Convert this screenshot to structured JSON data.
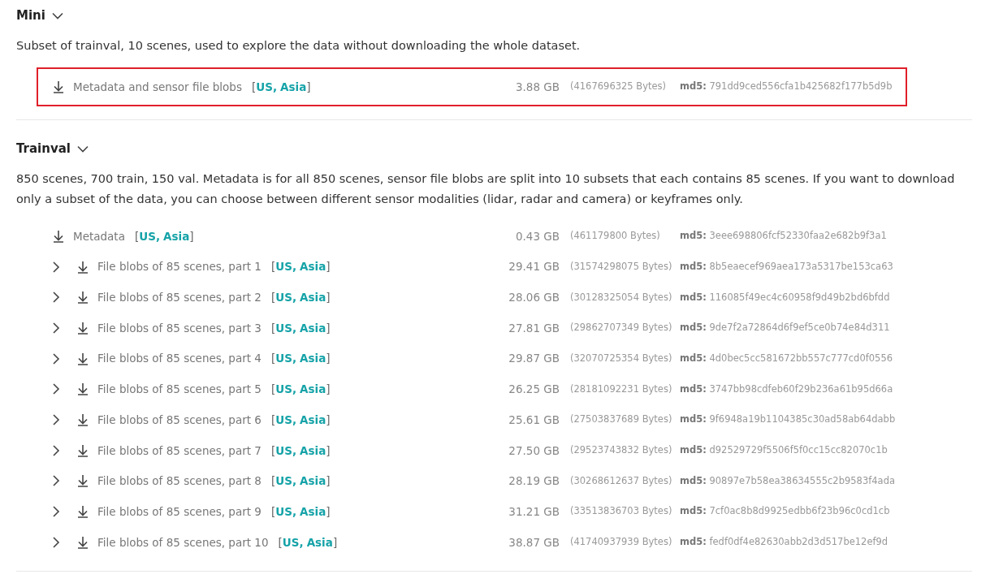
{
  "sections": [
    {
      "title": "Mini",
      "expanded": true,
      "description": "Subset of trainval, 10 scenes, used to explore the data without downloading the whole dataset.",
      "files": [
        {
          "name": "Metadata and sensor file blobs",
          "expandable": false,
          "highlighted": true,
          "regions": [
            {
              "kind": "punct",
              "text": "["
            },
            {
              "kind": "link",
              "text": "US"
            },
            {
              "kind": "punct",
              "text": ","
            },
            {
              "kind": "link",
              "text": "Asia"
            },
            {
              "kind": "punct",
              "text": "]"
            }
          ],
          "size": "3.88 GB",
          "bytes": "(4167696325 Bytes)",
          "md5_label": "md5:",
          "md5": "791dd9ced556cfa1b425682f177b5d9b"
        }
      ]
    },
    {
      "title": "Trainval",
      "expanded": true,
      "description": "850 scenes, 700 train, 150 val. Metadata is for all 850 scenes, sensor file blobs are split into 10 subsets that each contains 85 scenes. If you want to download only a subset of the data, you can choose between different sensor modalities (lidar, radar and camera) or keyframes only.",
      "files": [
        {
          "name": "Metadata",
          "expandable": false,
          "highlighted": false,
          "regions": [
            {
              "kind": "punct",
              "text": "["
            },
            {
              "kind": "link",
              "text": "US"
            },
            {
              "kind": "punct",
              "text": ","
            },
            {
              "kind": "link",
              "text": "Asia"
            },
            {
              "kind": "punct",
              "text": "]"
            }
          ],
          "size": "0.43 GB",
          "bytes": "(461179800 Bytes)",
          "md5_label": "md5:",
          "md5": "3eee698806fcf52330faa2e682b9f3a1"
        },
        {
          "name": "File blobs of 85 scenes, part 1",
          "expandable": true,
          "highlighted": false,
          "regions": [
            {
              "kind": "punct",
              "text": "["
            },
            {
              "kind": "link",
              "text": "US"
            },
            {
              "kind": "punct",
              "text": ","
            },
            {
              "kind": "link",
              "text": "Asia"
            },
            {
              "kind": "punct",
              "text": "]"
            }
          ],
          "size": "29.41 GB",
          "bytes": "(31574298075 Bytes)",
          "md5_label": "md5:",
          "md5": "8b5eaecef969aea173a5317be153ca63"
        },
        {
          "name": "File blobs of 85 scenes, part 2",
          "expandable": true,
          "highlighted": false,
          "regions": [
            {
              "kind": "punct",
              "text": "["
            },
            {
              "kind": "link",
              "text": "US"
            },
            {
              "kind": "punct",
              "text": ","
            },
            {
              "kind": "link",
              "text": "Asia"
            },
            {
              "kind": "punct",
              "text": "]"
            }
          ],
          "size": "28.06 GB",
          "bytes": "(30128325054 Bytes)",
          "md5_label": "md5:",
          "md5": "116085f49ec4c60958f9d49b2bd6bfdd"
        },
        {
          "name": "File blobs of 85 scenes, part 3",
          "expandable": true,
          "highlighted": false,
          "regions": [
            {
              "kind": "punct",
              "text": "["
            },
            {
              "kind": "link",
              "text": "US"
            },
            {
              "kind": "punct",
              "text": ","
            },
            {
              "kind": "link",
              "text": "Asia"
            },
            {
              "kind": "punct",
              "text": "]"
            }
          ],
          "size": "27.81 GB",
          "bytes": "(29862707349 Bytes)",
          "md5_label": "md5:",
          "md5": "9de7f2a72864d6f9ef5ce0b74e84d311"
        },
        {
          "name": "File blobs of 85 scenes, part 4",
          "expandable": true,
          "highlighted": false,
          "regions": [
            {
              "kind": "punct",
              "text": "["
            },
            {
              "kind": "link",
              "text": "US"
            },
            {
              "kind": "punct",
              "text": ","
            },
            {
              "kind": "link",
              "text": "Asia"
            },
            {
              "kind": "punct",
              "text": "]"
            }
          ],
          "size": "29.87 GB",
          "bytes": "(32070725354 Bytes)",
          "md5_label": "md5:",
          "md5": "4d0bec5cc581672bb557c777cd0f0556"
        },
        {
          "name": "File blobs of 85 scenes, part 5",
          "expandable": true,
          "highlighted": false,
          "regions": [
            {
              "kind": "punct",
              "text": "["
            },
            {
              "kind": "link",
              "text": "US"
            },
            {
              "kind": "punct",
              "text": ","
            },
            {
              "kind": "link",
              "text": "Asia"
            },
            {
              "kind": "punct",
              "text": "]"
            }
          ],
          "size": "26.25 GB",
          "bytes": "(28181092231 Bytes)",
          "md5_label": "md5:",
          "md5": "3747bb98cdfeb60f29b236a61b95d66a"
        },
        {
          "name": "File blobs of 85 scenes, part 6",
          "expandable": true,
          "highlighted": false,
          "regions": [
            {
              "kind": "punct",
              "text": "["
            },
            {
              "kind": "link",
              "text": "US"
            },
            {
              "kind": "punct",
              "text": ","
            },
            {
              "kind": "link",
              "text": "Asia"
            },
            {
              "kind": "punct",
              "text": "]"
            }
          ],
          "size": "25.61 GB",
          "bytes": "(27503837689 Bytes)",
          "md5_label": "md5:",
          "md5": "9f6948a19b1104385c30ad58ab64dabb"
        },
        {
          "name": "File blobs of 85 scenes, part 7",
          "expandable": true,
          "highlighted": false,
          "regions": [
            {
              "kind": "punct",
              "text": "["
            },
            {
              "kind": "link",
              "text": "US"
            },
            {
              "kind": "punct",
              "text": ","
            },
            {
              "kind": "link",
              "text": "Asia"
            },
            {
              "kind": "punct",
              "text": "]"
            }
          ],
          "size": "27.50 GB",
          "bytes": "(29523743832 Bytes)",
          "md5_label": "md5:",
          "md5": "d92529729f5506f5f0cc15cc82070c1b"
        },
        {
          "name": "File blobs of 85 scenes, part 8",
          "expandable": true,
          "highlighted": false,
          "regions": [
            {
              "kind": "punct",
              "text": "["
            },
            {
              "kind": "link",
              "text": "US"
            },
            {
              "kind": "punct",
              "text": ","
            },
            {
              "kind": "link",
              "text": "Asia"
            },
            {
              "kind": "punct",
              "text": "]"
            }
          ],
          "size": "28.19 GB",
          "bytes": "(30268612637 Bytes)",
          "md5_label": "md5:",
          "md5": "90897e7b58ea38634555c2b9583f4ada"
        },
        {
          "name": "File blobs of 85 scenes, part 9",
          "expandable": true,
          "highlighted": false,
          "regions": [
            {
              "kind": "punct",
              "text": "["
            },
            {
              "kind": "link",
              "text": "US"
            },
            {
              "kind": "punct",
              "text": ","
            },
            {
              "kind": "link",
              "text": "Asia"
            },
            {
              "kind": "punct",
              "text": "]"
            }
          ],
          "size": "31.21 GB",
          "bytes": "(33513836703 Bytes)",
          "md5_label": "md5:",
          "md5": "7cf0ac8b8d9925edbb6f23b96c0cd1cb"
        },
        {
          "name": "File blobs of 85 scenes, part 10",
          "expandable": true,
          "highlighted": false,
          "regions": [
            {
              "kind": "punct",
              "text": "["
            },
            {
              "kind": "link",
              "text": "US"
            },
            {
              "kind": "punct",
              "text": ","
            },
            {
              "kind": "link",
              "text": "Asia"
            },
            {
              "kind": "punct",
              "text": "]"
            }
          ],
          "size": "38.87 GB",
          "bytes": "(41740937939 Bytes)",
          "md5_label": "md5:",
          "md5": "fedf0df4e82630abb2d3d517be12ef9d"
        }
      ]
    }
  ]
}
